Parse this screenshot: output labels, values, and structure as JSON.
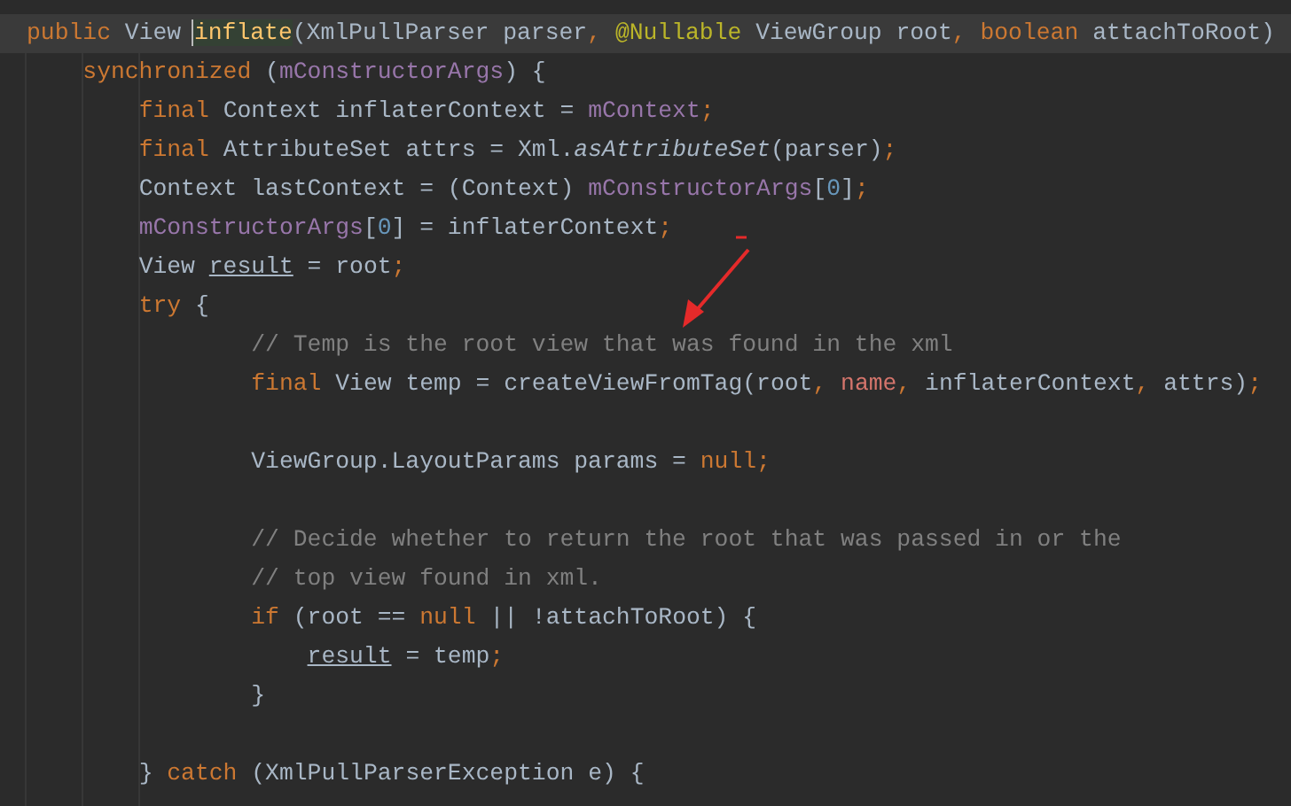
{
  "editor": {
    "lines": [
      {
        "kind": "code",
        "current": true,
        "tokens": [
          {
            "text": "public",
            "kind": "keyword"
          },
          {
            "text": " View ",
            "kind": "plain"
          },
          {
            "text": "inflate",
            "kind": "method",
            "cursor": true
          },
          {
            "text": "(XmlPullParser parser",
            "kind": "plain"
          },
          {
            "text": ",",
            "kind": "keyword"
          },
          {
            "text": " @Nullable",
            "kind": "annotation"
          },
          {
            "text": " ViewGroup root",
            "kind": "plain"
          },
          {
            "text": ",",
            "kind": "keyword"
          },
          {
            "text": " boolean",
            "kind": "keyword"
          },
          {
            "text": " attachToRoot)",
            "kind": "plain"
          }
        ]
      },
      {
        "kind": "code",
        "current": false,
        "tokens": [
          {
            "text": "    synchronized",
            "kind": "keyword"
          },
          {
            "text": " (",
            "kind": "plain"
          },
          {
            "text": "mConstructorArgs",
            "kind": "field"
          },
          {
            "text": ") {",
            "kind": "plain"
          }
        ]
      },
      {
        "kind": "code",
        "current": false,
        "tokens": [
          {
            "text": "        final",
            "kind": "keyword"
          },
          {
            "text": " Context inflaterContext = ",
            "kind": "plain"
          },
          {
            "text": "mContext",
            "kind": "field"
          },
          {
            "text": ";",
            "kind": "keyword"
          }
        ]
      },
      {
        "kind": "code",
        "current": false,
        "tokens": [
          {
            "text": "        final",
            "kind": "keyword"
          },
          {
            "text": " AttributeSet attrs = Xml.",
            "kind": "plain"
          },
          {
            "text": "asAttributeSet",
            "kind": "static"
          },
          {
            "text": "(parser)",
            "kind": "plain"
          },
          {
            "text": ";",
            "kind": "keyword"
          }
        ]
      },
      {
        "kind": "code",
        "current": false,
        "tokens": [
          {
            "text": "        Context lastContext = (Context) ",
            "kind": "plain"
          },
          {
            "text": "mConstructorArgs",
            "kind": "field"
          },
          {
            "text": "[",
            "kind": "plain"
          },
          {
            "text": "0",
            "kind": "number"
          },
          {
            "text": "]",
            "kind": "plain"
          },
          {
            "text": ";",
            "kind": "keyword"
          }
        ]
      },
      {
        "kind": "code",
        "current": false,
        "tokens": [
          {
            "text": "        mConstructorArgs",
            "kind": "field"
          },
          {
            "text": "[",
            "kind": "plain"
          },
          {
            "text": "0",
            "kind": "number"
          },
          {
            "text": "] = inflaterContext",
            "kind": "plain"
          },
          {
            "text": ";",
            "kind": "keyword"
          }
        ]
      },
      {
        "kind": "code",
        "current": false,
        "tokens": [
          {
            "text": "        View ",
            "kind": "plain"
          },
          {
            "text": "result",
            "kind": "reassigned"
          },
          {
            "text": " = root",
            "kind": "plain"
          },
          {
            "text": ";",
            "kind": "keyword"
          }
        ]
      },
      {
        "kind": "code",
        "current": false,
        "tokens": [
          {
            "text": "        try",
            "kind": "keyword"
          },
          {
            "text": " {",
            "kind": "plain"
          }
        ]
      },
      {
        "kind": "code",
        "current": false,
        "tokens": [
          {
            "text": "                // Temp is the root view that was found in the xml",
            "kind": "comment"
          }
        ]
      },
      {
        "kind": "code",
        "current": false,
        "tokens": [
          {
            "text": "                final",
            "kind": "keyword"
          },
          {
            "text": " View temp = createViewFromTag(root",
            "kind": "plain"
          },
          {
            "text": ",",
            "kind": "keyword"
          },
          {
            "text": " name",
            "kind": "param"
          },
          {
            "text": ",",
            "kind": "keyword"
          },
          {
            "text": " inflaterContext",
            "kind": "plain"
          },
          {
            "text": ",",
            "kind": "keyword"
          },
          {
            "text": " attrs)",
            "kind": "plain"
          },
          {
            "text": ";",
            "kind": "keyword"
          }
        ]
      },
      {
        "kind": "blank",
        "current": false
      },
      {
        "kind": "code",
        "current": false,
        "tokens": [
          {
            "text": "                ViewGroup.LayoutParams params = ",
            "kind": "plain"
          },
          {
            "text": "null",
            "kind": "keyword"
          },
          {
            "text": ";",
            "kind": "keyword"
          }
        ]
      },
      {
        "kind": "blank",
        "current": false
      },
      {
        "kind": "code",
        "current": false,
        "tokens": [
          {
            "text": "                // Decide whether to return the root that was passed in or the",
            "kind": "comment"
          }
        ]
      },
      {
        "kind": "code",
        "current": false,
        "tokens": [
          {
            "text": "                // top view found in xml.",
            "kind": "comment"
          }
        ]
      },
      {
        "kind": "code",
        "current": false,
        "tokens": [
          {
            "text": "                if",
            "kind": "keyword"
          },
          {
            "text": " (root == ",
            "kind": "plain"
          },
          {
            "text": "null",
            "kind": "keyword"
          },
          {
            "text": " || !attachToRoot) {",
            "kind": "plain"
          }
        ]
      },
      {
        "kind": "code",
        "current": false,
        "tokens": [
          {
            "text": "                    result",
            "kind": "reassigned"
          },
          {
            "text": " = temp",
            "kind": "plain"
          },
          {
            "text": ";",
            "kind": "keyword"
          }
        ]
      },
      {
        "kind": "code",
        "current": false,
        "tokens": [
          {
            "text": "                }",
            "kind": "plain"
          }
        ]
      },
      {
        "kind": "blank",
        "current": false
      },
      {
        "kind": "code",
        "current": false,
        "tokens": [
          {
            "text": "        } ",
            "kind": "plain"
          },
          {
            "text": "catch",
            "kind": "keyword"
          },
          {
            "text": " (XmlPullParserException e) {",
            "kind": "plain"
          }
        ]
      }
    ]
  }
}
